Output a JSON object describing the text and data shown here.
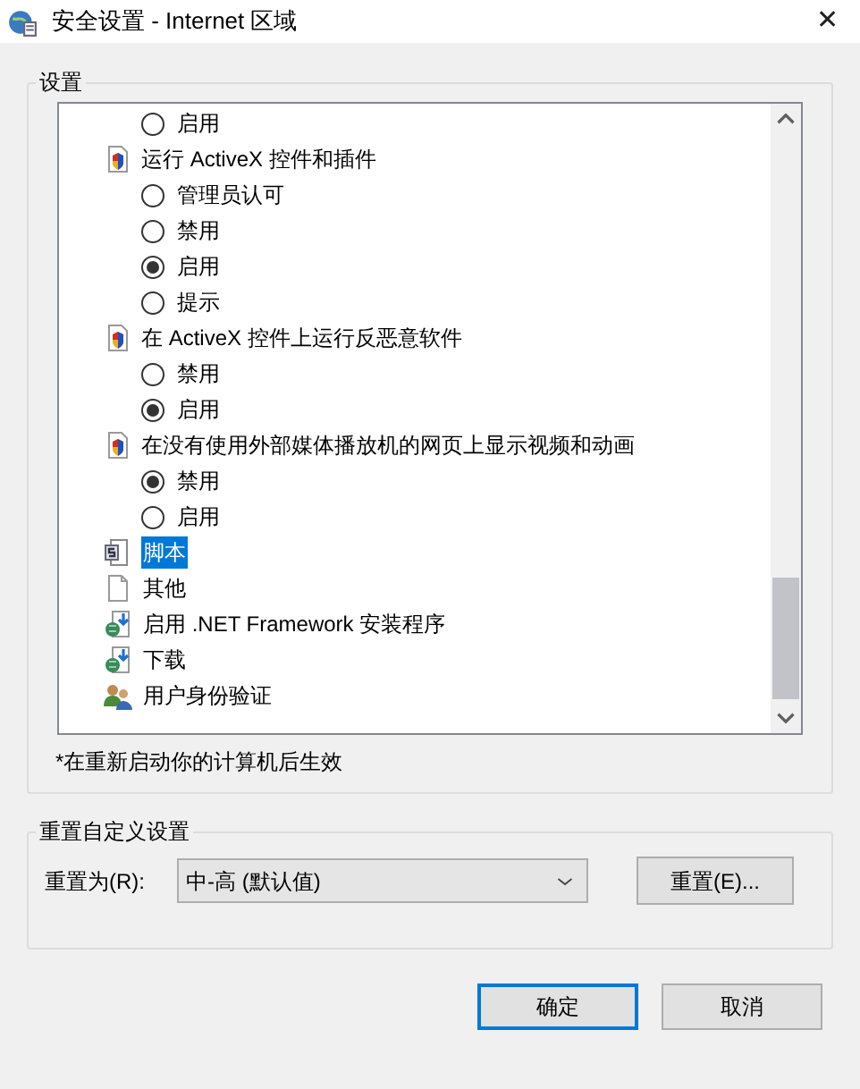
{
  "window": {
    "title": "安全设置 - Internet 区域",
    "close": "✕"
  },
  "settings_group": {
    "label": "设置",
    "tree": [
      {
        "kind": "continuation",
        "children": [
          {
            "kind": "continuation",
            "children": [
              {
                "kind": "radio",
                "label": "启用",
                "checked": false
              }
            ]
          },
          {
            "kind": "setting",
            "label": "运行 ActiveX 控件和插件",
            "children": [
              {
                "kind": "radio",
                "label": "管理员认可",
                "checked": false
              },
              {
                "kind": "radio",
                "label": "禁用",
                "checked": false
              },
              {
                "kind": "radio",
                "label": "启用",
                "checked": true
              },
              {
                "kind": "radio",
                "label": "提示",
                "checked": false
              }
            ]
          },
          {
            "kind": "setting",
            "label": "在 ActiveX 控件上运行反恶意软件",
            "children": [
              {
                "kind": "radio",
                "label": "禁用",
                "checked": false
              },
              {
                "kind": "radio",
                "label": "启用",
                "checked": true
              }
            ]
          },
          {
            "kind": "setting",
            "label": "在没有使用外部媒体播放机的网页上显示视频和动画",
            "children": [
              {
                "kind": "radio",
                "label": "禁用",
                "checked": true
              },
              {
                "kind": "radio",
                "label": "启用",
                "checked": false
              }
            ]
          }
        ]
      },
      {
        "kind": "category",
        "label": "脚本",
        "selected": true
      },
      {
        "kind": "category",
        "label": "其他",
        "selected": false
      },
      {
        "kind": "category",
        "label": "启用 .NET Framework 安装程序",
        "selected": false
      },
      {
        "kind": "category",
        "label": "下载",
        "selected": false
      },
      {
        "kind": "category",
        "label": "用户身份验证",
        "selected": false
      }
    ],
    "note": "*在重新启动你的计算机后生效"
  },
  "reset_group": {
    "label": "重置自定义设置",
    "field_label": "重置为(R):",
    "dropdown_value": "中-高 (默认值)",
    "reset_button": "重置(E)..."
  },
  "buttons": [
    {
      "label": "确定",
      "default": true
    },
    {
      "label": "取消",
      "default": false
    }
  ]
}
